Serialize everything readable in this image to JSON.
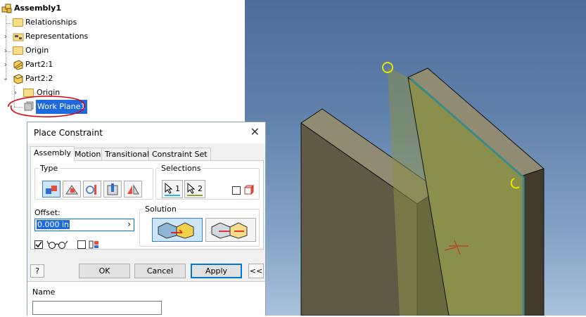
{
  "browser": {
    "root": "Assembly1",
    "items": [
      {
        "label": "Relationships",
        "icon": "folder-icon"
      },
      {
        "label": "Representations",
        "icon": "representations-icon"
      },
      {
        "label": "Origin",
        "icon": "folder-icon"
      },
      {
        "label": "Part2:1",
        "icon": "part-icon"
      },
      {
        "label": "Part2:2",
        "icon": "part-icon"
      },
      {
        "label": "Origin",
        "icon": "folder-icon"
      },
      {
        "label": "Work Plane1",
        "icon": "work-plane-icon"
      }
    ]
  },
  "dialog": {
    "title": "Place Constraint",
    "close_glyph": "✕",
    "tabs": [
      {
        "label": "Assembly",
        "active": true
      },
      {
        "label": "Motion"
      },
      {
        "label": "Transitional"
      },
      {
        "label": "Constraint Set"
      }
    ],
    "type_label": "Type",
    "type_buttons": [
      "mate-icon",
      "angle-icon",
      "tangent-icon",
      "insert-icon",
      "symmetry-icon"
    ],
    "selections_label": "Selections",
    "selection_1": "1",
    "selection_2": "2",
    "offset_label": "Offset:",
    "offset_value": "0.000 in",
    "solution_label": "Solution",
    "buttons": {
      "help": "?",
      "ok": "OK",
      "cancel": "Cancel",
      "apply": "Apply",
      "more": "<<"
    },
    "name_label": "Name",
    "name_value": ""
  },
  "colors": {
    "accent": "#0078d7",
    "selection": "#1d6ae0",
    "highlight_circle": "#e0010a",
    "plate": "#7f7d58",
    "plate_selected": "#8a8f4b"
  }
}
